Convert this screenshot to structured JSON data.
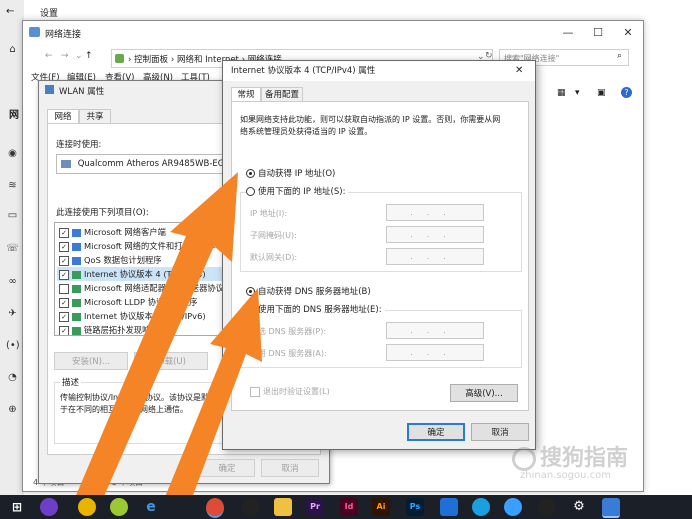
{
  "settings": {
    "title": "设置",
    "side_icons": [
      "home-icon",
      "globe-icon",
      "wifi-icon",
      "ethernet-icon",
      "dialup-icon",
      "vpn-icon",
      "airplane-icon",
      "hotspot-icon",
      "data-usage-icon",
      "proxy-icon"
    ],
    "partial_heading": "网"
  },
  "explorer": {
    "title": "网络连接",
    "breadcrumb": [
      "控制面板",
      "网络和 Internet",
      "网络连接"
    ],
    "search_placeholder": "搜索\"网络连接\"",
    "menu": [
      "文件(F)",
      "编辑(E)",
      "查看(V)",
      "高级(N)",
      "工具(T)"
    ],
    "status_left": "4 个项目",
    "status_mid": "选中 1 个项目"
  },
  "wlan": {
    "title": "WLAN 属性",
    "tabs": [
      "网络",
      "共享"
    ],
    "connect_using_label": "连接时使用:",
    "adapter_name": "Qualcomm Atheros AR9485WB-EG V",
    "items_label": "此连接使用下列项目(O):",
    "items": [
      {
        "checked": true,
        "label": "Microsoft 网络客户端"
      },
      {
        "checked": true,
        "label": "Microsoft 网络的文件和打印机共享"
      },
      {
        "checked": true,
        "label": "QoS 数据包计划程序"
      },
      {
        "checked": true,
        "label": "Internet 协议版本 4 (TCP/IPv4)"
      },
      {
        "checked": false,
        "label": "Microsoft 网络适配器多路传送器协议"
      },
      {
        "checked": true,
        "label": "Microsoft LLDP 协议驱动程序"
      },
      {
        "checked": true,
        "label": "Internet 协议版本 6 (TCP/IPv6)"
      },
      {
        "checked": true,
        "label": "链路层拓扑发现响应程序"
      }
    ],
    "install_button": "安装(N)...",
    "uninstall_button": "卸载(U)",
    "description_title": "描述",
    "description_text_1": "传输控制协议/Internet 协议。该协议是默认的广域网络协议，用",
    "description_text_2": "于在不同的相互连接的网络上通信。",
    "ok_button": "确定",
    "cancel_button": "取消"
  },
  "ipv4": {
    "title": "Internet 协议版本 4 (TCP/IPv4) 属性",
    "tabs": [
      "常规",
      "备用配置"
    ],
    "intro_1": "如果网络支持此功能，则可以获取自动指派的 IP 设置。否则，你需要从网",
    "intro_2": "络系统管理员处获得适当的 IP 设置。",
    "auto_ip": "自动获得 IP 地址(O)",
    "manual_ip": "使用下面的 IP 地址(S):",
    "ip_address": "IP 地址(I):",
    "subnet_mask": "子网掩码(U):",
    "gateway": "默认网关(D):",
    "auto_dns": "自动获得 DNS 服务器地址(B)",
    "manual_dns": "使用下面的 DNS 服务器地址(E):",
    "preferred_dns": "首选 DNS 服务器(P):",
    "alternate_dns": "备用 DNS 服务器(A):",
    "ip_dots": "...",
    "validate_on_exit": "退出时验证设置(L)",
    "advanced_button": "高级(V)...",
    "ok_button": "确定",
    "cancel_button": "取消",
    "selected_ip_mode": "auto",
    "selected_dns_mode": "auto"
  },
  "watermark": {
    "text": "搜狗指南",
    "sub": "zhinan.sogou.com"
  },
  "taskbar": {
    "icons": [
      "windows-icon",
      "cortana-icon",
      "store-icon",
      "edge-icon",
      "chrome-icon",
      "qq-icon",
      "explorer-icon",
      "premiere-icon",
      "indesign-icon",
      "illustrator-icon",
      "photoshop-icon",
      "security-icon",
      "feishu-icon",
      "browser-icon",
      "qq2-icon",
      "settings-icon",
      "network-icon"
    ]
  },
  "colors": {
    "arrow": "#f58426",
    "accent": "#2a7ad6",
    "taskbar": "#1b1f27"
  }
}
